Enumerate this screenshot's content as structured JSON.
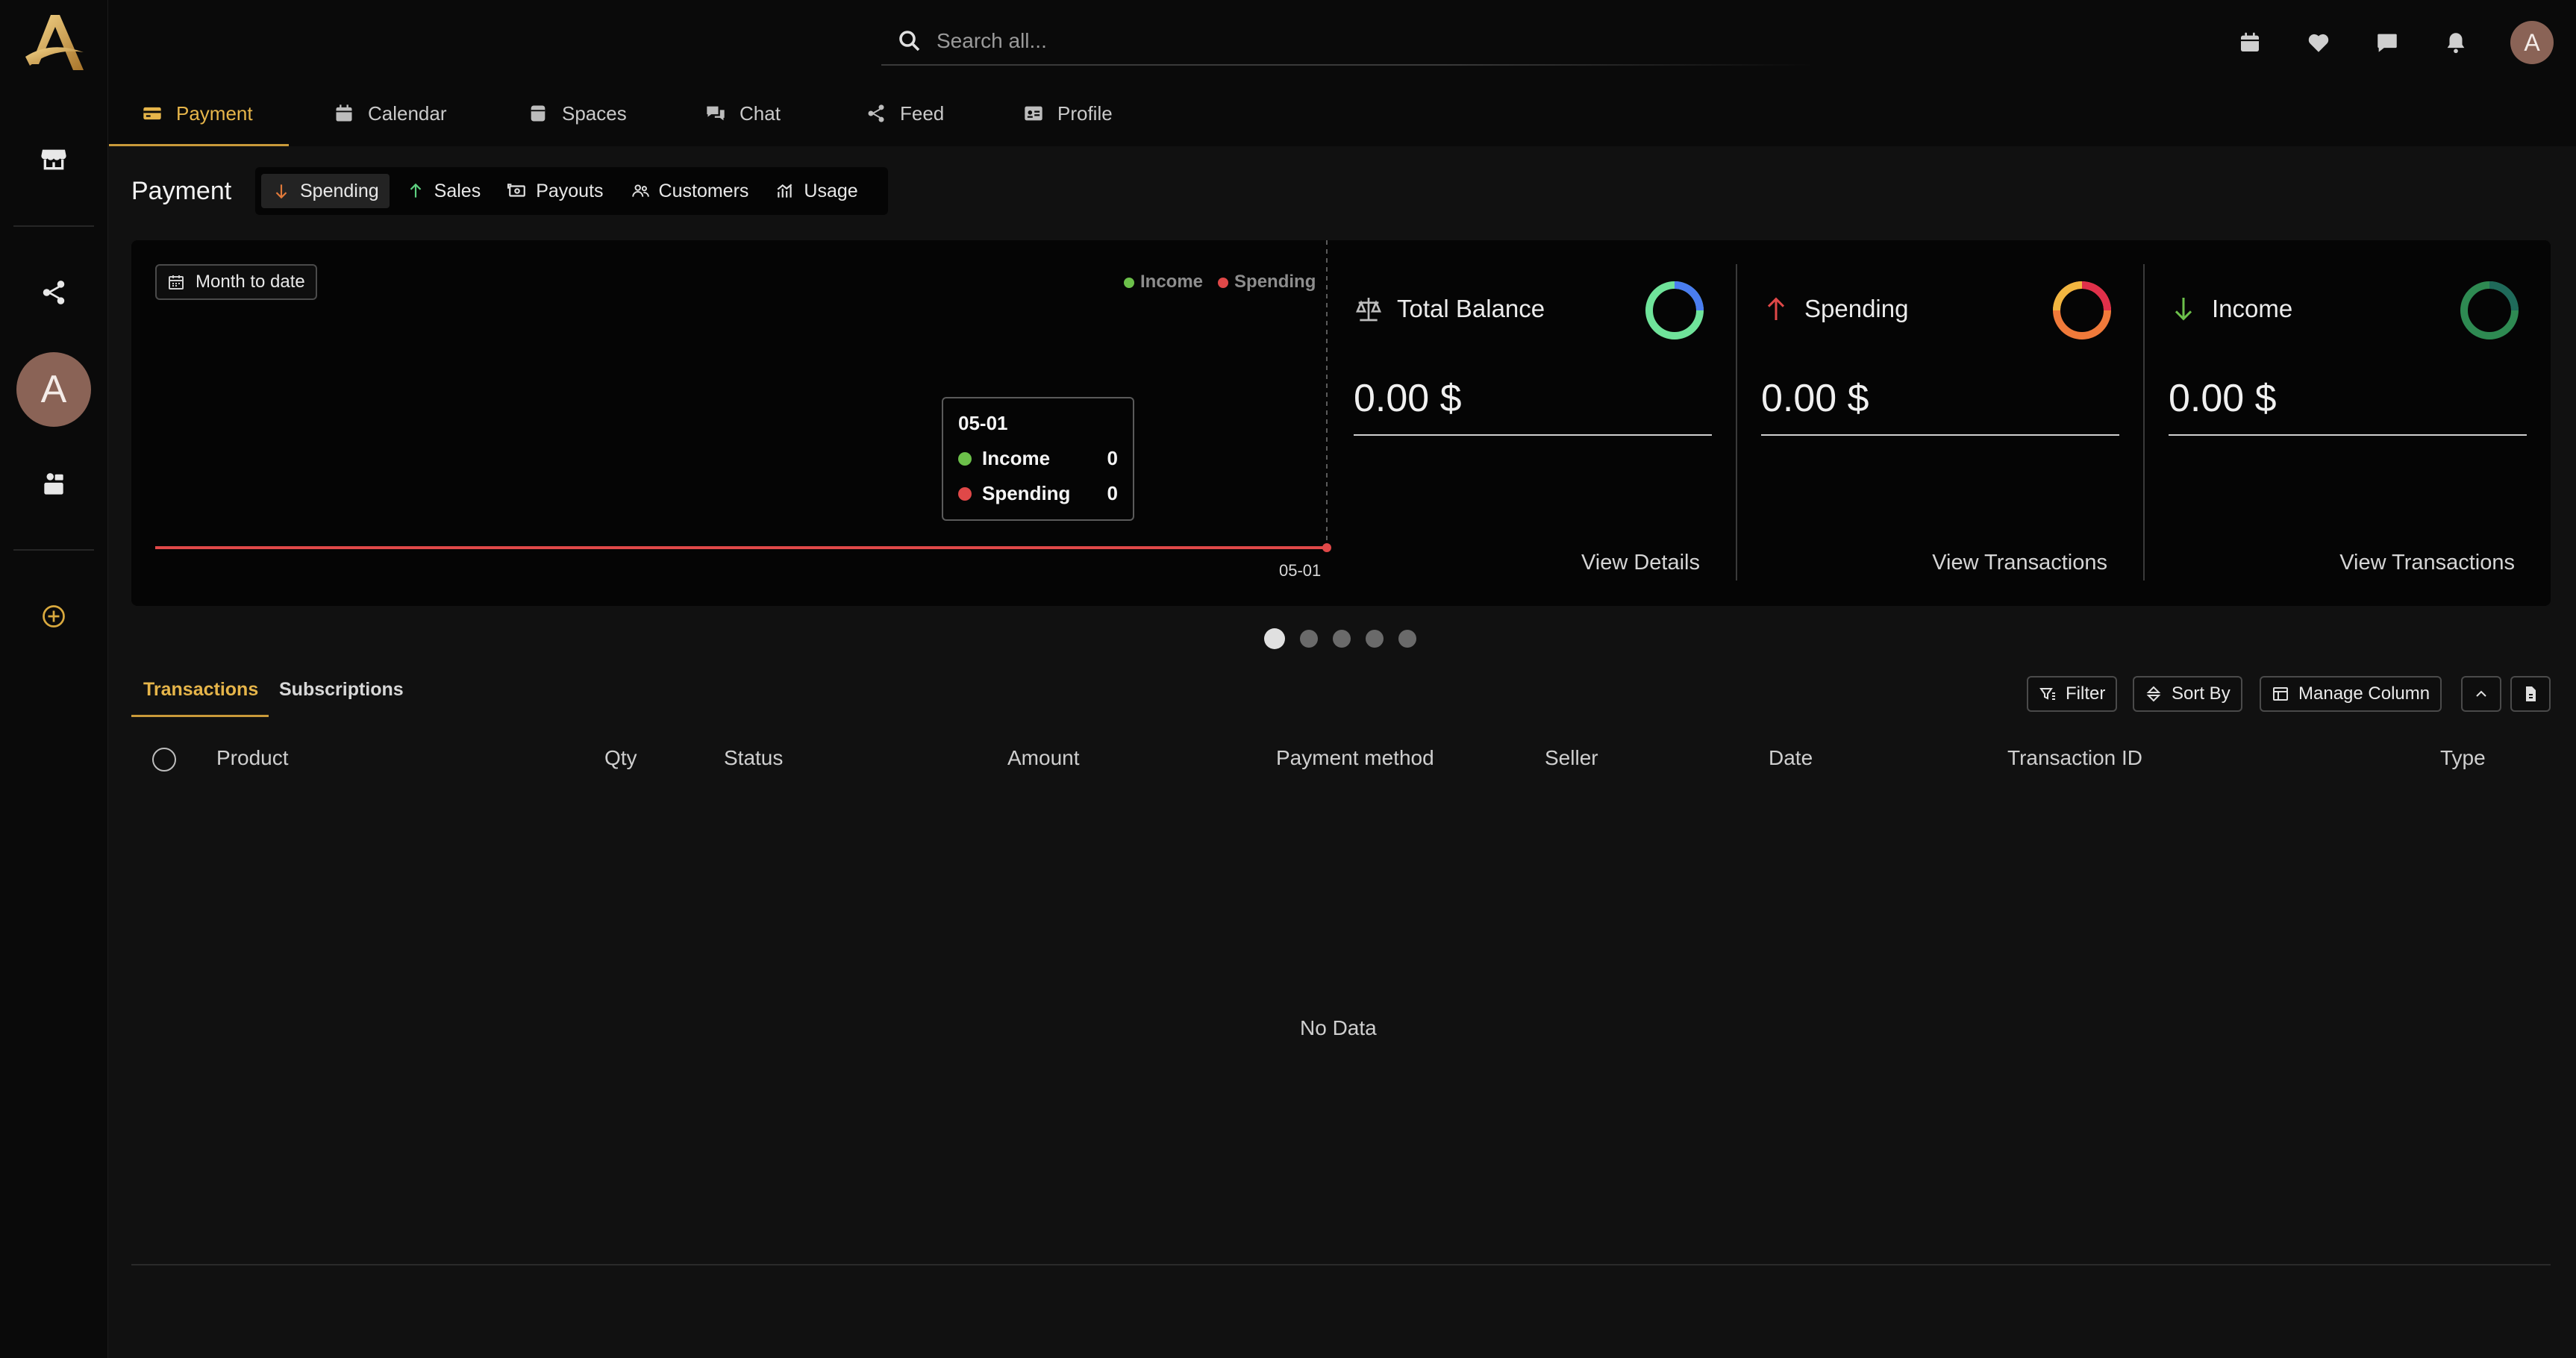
{
  "search": {
    "placeholder": "Search all..."
  },
  "nav_tabs": [
    {
      "label": "Payment",
      "icon": "credit-card-icon"
    },
    {
      "label": "Calendar",
      "icon": "calendar-icon"
    },
    {
      "label": "Spaces",
      "icon": "spaces-icon"
    },
    {
      "label": "Chat",
      "icon": "chat-icon"
    },
    {
      "label": "Feed",
      "icon": "share-icon"
    },
    {
      "label": "Profile",
      "icon": "id-card-icon"
    }
  ],
  "user": {
    "initial": "A"
  },
  "payment": {
    "title": "Payment",
    "subtabs": [
      {
        "label": "Spending",
        "icon": "arrow-down-icon"
      },
      {
        "label": "Sales",
        "icon": "arrow-up-icon"
      },
      {
        "label": "Payouts",
        "icon": "payouts-icon"
      },
      {
        "label": "Customers",
        "icon": "customers-icon"
      },
      {
        "label": "Usage",
        "icon": "usage-icon"
      }
    ]
  },
  "chart": {
    "range_label": "Month to date",
    "legend": [
      "Income",
      "Spending"
    ],
    "tooltip": {
      "date": "05-01",
      "income_label": "Income",
      "income_value": "0",
      "spending_label": "Spending",
      "spending_value": "0"
    },
    "x_tick": "05-01"
  },
  "chart_data": {
    "type": "line",
    "x": [
      "05-01"
    ],
    "series": [
      {
        "name": "Income",
        "values": [
          0
        ]
      },
      {
        "name": "Spending",
        "values": [
          0
        ]
      }
    ],
    "legend": "top-right"
  },
  "stats": [
    {
      "label": "Total Balance",
      "value": "0.00 $",
      "link": "View Details",
      "icon": "scale-icon"
    },
    {
      "label": "Spending",
      "value": "0.00 $",
      "link": "View Transactions",
      "icon": "arrow-up-icon"
    },
    {
      "label": "Income",
      "value": "0.00 $",
      "link": "View Transactions",
      "icon": "arrow-down-icon"
    }
  ],
  "table": {
    "tabs": [
      "Transactions",
      "Subscriptions"
    ],
    "buttons": {
      "filter": "Filter",
      "sort": "Sort By",
      "manage": "Manage Column"
    },
    "columns": [
      "Product",
      "Qty",
      "Status",
      "Amount",
      "Payment method",
      "Seller",
      "Date",
      "Transaction ID",
      "Type"
    ],
    "empty": "No Data"
  },
  "colors": {
    "accent": "#e6b54a",
    "income": "#6cc04a",
    "spending": "#e04848"
  }
}
